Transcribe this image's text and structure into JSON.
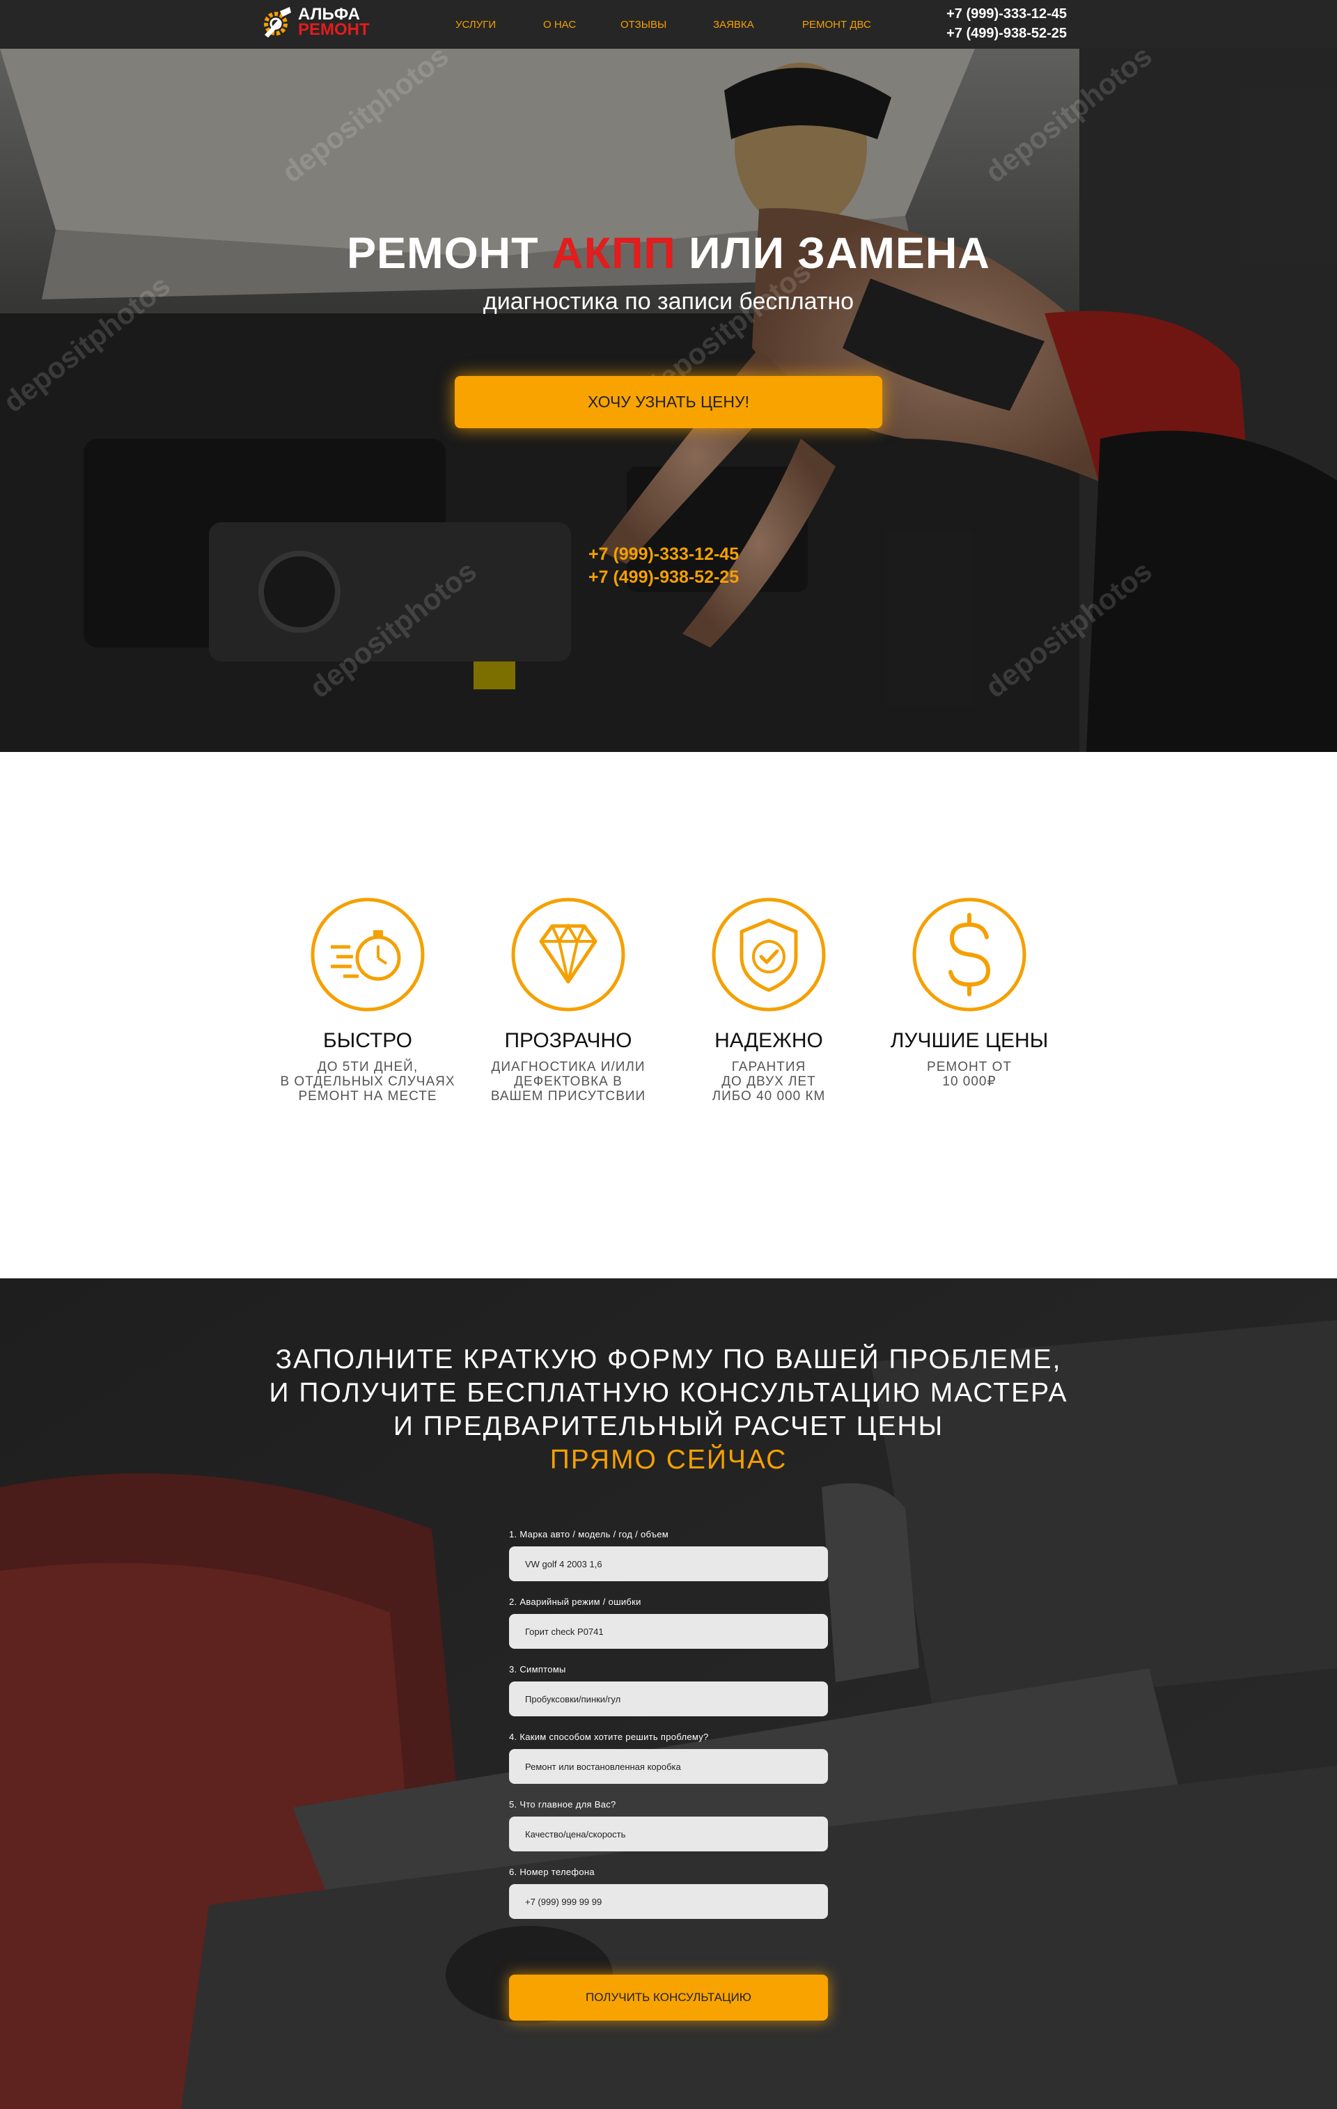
{
  "header": {
    "logo_line1": "АЛЬФА",
    "logo_line2": "РЕМОНТ",
    "nav": [
      "УСЛУГИ",
      "О НАС",
      "ОТЗЫВЫ",
      "ЗАЯВКА",
      "РЕМОНТ ДВС"
    ],
    "phones": [
      "+7 (999)-333-12-45",
      "+7 (499)-938-52-25"
    ]
  },
  "hero": {
    "title_part1": "РЕМОНТ ",
    "title_accent": "АКПП",
    "title_part2": " ИЛИ ЗАМЕНА",
    "subtitle": "диагностика по записи бесплатно",
    "cta_label": "ХОЧУ УЗНАТЬ ЦЕНУ!",
    "phones": [
      "+7 (999)-333-12-45",
      "+7 (499)-938-52-25"
    ],
    "watermark": "depositphotos"
  },
  "features": [
    {
      "icon": "stopwatch-icon",
      "title": "БЫСТРО",
      "desc": "ДО 5ТИ ДНЕЙ,\nВ ОТДЕЛЬНЫХ СЛУЧАЯХ\nРЕМОНТ НА МЕСТЕ"
    },
    {
      "icon": "diamond-icon",
      "title": "ПРОЗРАЧНО",
      "desc": "ДИАГНОСТИКА И/ИЛИ\nДЕФЕКТОВКА В\nВАШЕМ ПРИСУТСВИИ"
    },
    {
      "icon": "shield-check-icon",
      "title": "НАДЕЖНО",
      "desc": "ГАРАНТИЯ\nДО ДВУХ ЛЕТ\nЛИБО 40 000 КМ"
    },
    {
      "icon": "dollar-icon",
      "title": "ЛУЧШИЕ ЦЕНЫ",
      "desc": "РЕМОНТ ОТ\n10 000₽"
    }
  ],
  "form": {
    "title_lines": [
      "ЗАПОЛНИТЕ КРАТКУЮ ФОРМУ ПО ВАШЕЙ ПРОБЛЕМЕ,",
      "И ПОЛУЧИТЕ БЕСПЛАТНУЮ КОНСУЛЬТАЦИЮ МАСТЕРА",
      "И ПРЕДВАРИТЕЛЬНЫЙ РАСЧЕТ ЦЕНЫ"
    ],
    "title_accent": "ПРЯМО СЕЙЧАС",
    "fields": [
      {
        "label": "1. Марка авто / модель / год / объем",
        "placeholder": "VW golf 4 2003 1,6"
      },
      {
        "label": "2. Аварийный режим / ошибки",
        "placeholder": "Горит check P0741"
      },
      {
        "label": "3. Симптомы",
        "placeholder": "Пробуксовки/пинки/гул"
      },
      {
        "label": "4. Каким способом хотите решить проблему?",
        "placeholder": "Ремонт или востановленная коробка"
      },
      {
        "label": "5. Что главное для Вас?",
        "placeholder": "Качество/цена/скорость"
      },
      {
        "label": "6. Номер телефона",
        "placeholder": "+7 (999) 999 99 99"
      }
    ],
    "submit_label": "ПОЛУЧИТЬ КОНСУЛЬТАЦИЮ"
  },
  "colors": {
    "accent": "#f9a300",
    "red": "#e11d1d",
    "header_bg": "#262626"
  }
}
